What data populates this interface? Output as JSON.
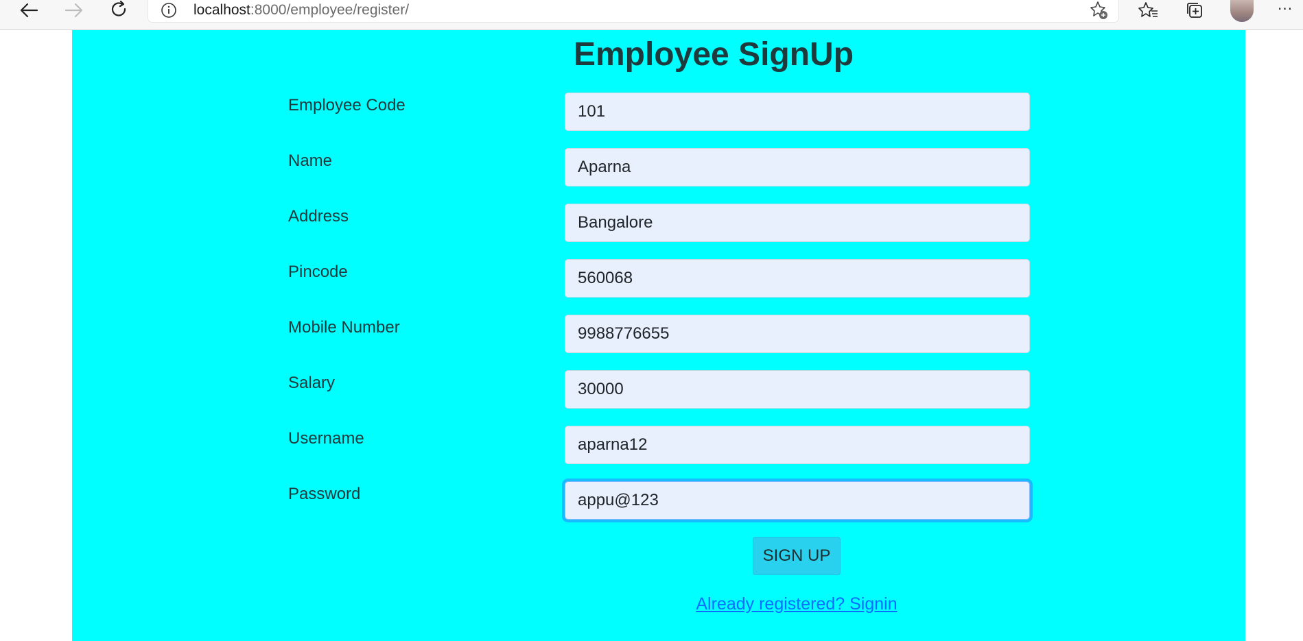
{
  "browser": {
    "url_host": "localhost",
    "url_path": ":8000/employee/register/",
    "icons": {
      "back": "back-arrow-icon",
      "forward": "forward-arrow-icon",
      "reload": "reload-icon",
      "info": "info-icon",
      "add_favorite": "star-plus-icon",
      "favorites": "favorites-list-icon",
      "collections": "collections-icon",
      "profile": "profile-avatar",
      "more": "more-icon"
    },
    "more_glyph": "···"
  },
  "form": {
    "title": "Employee SignUp",
    "fields": [
      {
        "label": "Employee Code",
        "value": "101"
      },
      {
        "label": "Name",
        "value": "Aparna"
      },
      {
        "label": "Address",
        "value": "Bangalore"
      },
      {
        "label": "Pincode",
        "value": "560068"
      },
      {
        "label": "Mobile Number",
        "value": "9988776655"
      },
      {
        "label": "Salary",
        "value": "30000"
      },
      {
        "label": "Username",
        "value": "aparna12"
      },
      {
        "label": "Password",
        "value": "appu@123"
      }
    ],
    "submit_label": "SIGN UP",
    "signin_link": "Already registered? Signin"
  },
  "colors": {
    "page_background": "#00ffff",
    "input_background": "#e8f0fe",
    "button_background": "#2ad1ee",
    "link": "#0d6efd",
    "focus_ring": "#1fa4ff"
  }
}
